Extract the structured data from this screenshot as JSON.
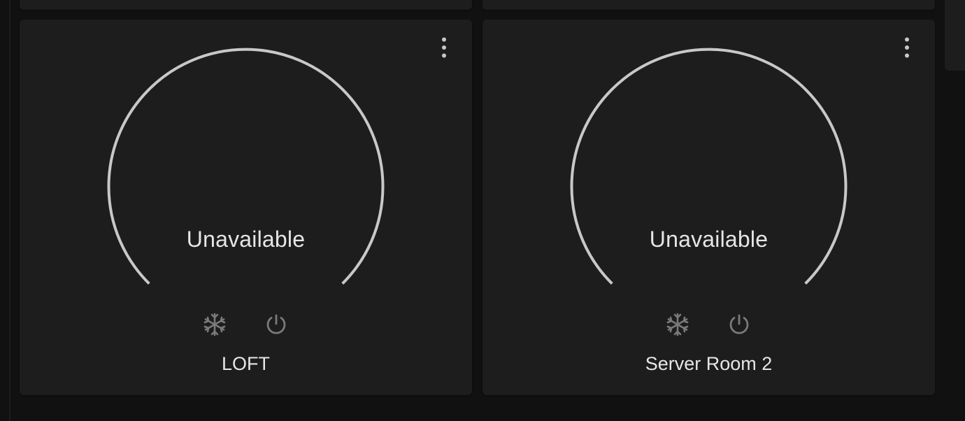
{
  "thermostats": [
    {
      "name": "LOFT",
      "status": "Unavailable",
      "modes": [
        "cool",
        "off"
      ],
      "menu_icon": "dots-vertical-icon"
    },
    {
      "name": "Server Room 2",
      "status": "Unavailable",
      "modes": [
        "cool",
        "off"
      ],
      "menu_icon": "dots-vertical-icon"
    }
  ],
  "colors": {
    "background": "#111111",
    "card": "#1d1d1d",
    "text": "#e6e6e6",
    "dial_track": "#c8c8c8",
    "icon": "#7a7a7a"
  }
}
